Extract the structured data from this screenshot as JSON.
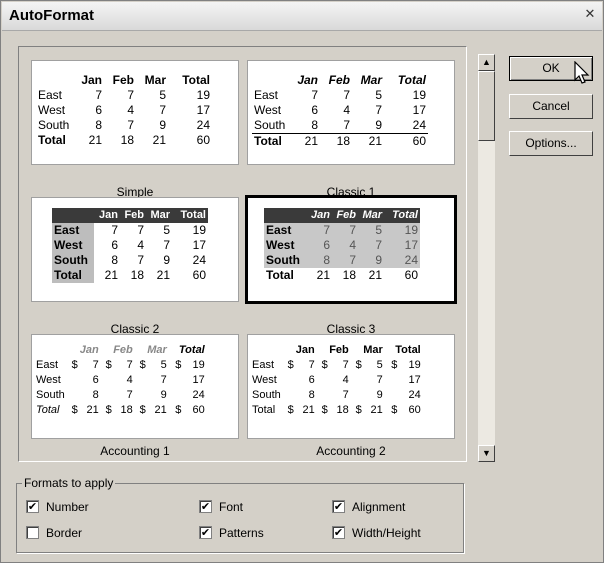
{
  "window": {
    "title": "AutoFormat",
    "close_glyph": "✕"
  },
  "samples": {
    "simple": {
      "caption": "Simple",
      "headers": [
        "",
        "Jan",
        "Feb",
        "Mar",
        "Total"
      ],
      "rows": [
        [
          "East",
          "7",
          "7",
          "5",
          "19"
        ],
        [
          "West",
          "6",
          "4",
          "7",
          "17"
        ],
        [
          "South",
          "8",
          "7",
          "9",
          "24"
        ],
        [
          "Total",
          "21",
          "18",
          "21",
          "60"
        ]
      ]
    },
    "classic1": {
      "caption": "Classic 1",
      "headers": [
        "",
        "Jan",
        "Feb",
        "Mar",
        "Total"
      ],
      "rows": [
        [
          "East",
          "7",
          "7",
          "5",
          "19"
        ],
        [
          "West",
          "6",
          "4",
          "7",
          "17"
        ],
        [
          "South",
          "8",
          "7",
          "9",
          "24"
        ],
        [
          "Total",
          "21",
          "18",
          "21",
          "60"
        ]
      ]
    },
    "classic2": {
      "caption": "Classic 2",
      "headers": [
        "",
        "Jan",
        "Feb",
        "Mar",
        "Total"
      ],
      "rows": [
        [
          "East",
          "7",
          "7",
          "5",
          "19"
        ],
        [
          "West",
          "6",
          "4",
          "7",
          "17"
        ],
        [
          "South",
          "8",
          "7",
          "9",
          "24"
        ],
        [
          "Total",
          "21",
          "18",
          "21",
          "60"
        ]
      ]
    },
    "classic3": {
      "caption": "Classic 3",
      "headers": [
        "",
        "Jan",
        "Feb",
        "Mar",
        "Total"
      ],
      "rows": [
        [
          "East",
          "7",
          "7",
          "5",
          "19"
        ],
        [
          "West",
          "6",
          "4",
          "7",
          "17"
        ],
        [
          "South",
          "8",
          "7",
          "9",
          "24"
        ],
        [
          "Total",
          "21",
          "18",
          "21",
          "60"
        ]
      ]
    },
    "accounting1": {
      "caption": "Accounting 1",
      "headers": [
        "",
        "Jan",
        "Feb",
        "Mar",
        "Total"
      ],
      "rows": [
        [
          "East",
          "$",
          "7",
          "$",
          "7",
          "$",
          "5",
          "$",
          "19"
        ],
        [
          "West",
          "",
          "6",
          "",
          "4",
          "",
          "7",
          "",
          "17"
        ],
        [
          "South",
          "",
          "8",
          "",
          "7",
          "",
          "9",
          "",
          "24"
        ],
        [
          "Total",
          "$",
          "21",
          "$",
          "18",
          "$",
          "21",
          "$",
          "60"
        ]
      ]
    },
    "accounting2": {
      "caption": "Accounting 2",
      "headers": [
        "",
        "Jan",
        "Feb",
        "Mar",
        "Total"
      ],
      "rows": [
        [
          "East",
          "$",
          "7",
          "$",
          "5",
          "$",
          "19"
        ],
        [
          "West",
          "6",
          "4",
          "7",
          "17"
        ],
        [
          "South",
          "8",
          "7",
          "9",
          "24"
        ],
        [
          "Total",
          "$",
          "21",
          "$",
          "18",
          "$",
          "21",
          "$",
          "60"
        ]
      ]
    }
  },
  "buttons": {
    "ok": "OK",
    "cancel": "Cancel",
    "options": "Options..."
  },
  "formats": {
    "legend": "Formats to apply",
    "number": {
      "label": "Number",
      "checked": true
    },
    "font": {
      "label": "Font",
      "checked": true
    },
    "alignment": {
      "label": "Alignment",
      "checked": true
    },
    "border": {
      "label": "Border",
      "checked": false
    },
    "patterns": {
      "label": "Patterns",
      "checked": true
    },
    "width_height": {
      "label": "Width/Height",
      "checked": true
    }
  },
  "glyphs": {
    "check": "✔",
    "scroll_up": "▲",
    "scroll_down": "▼"
  }
}
